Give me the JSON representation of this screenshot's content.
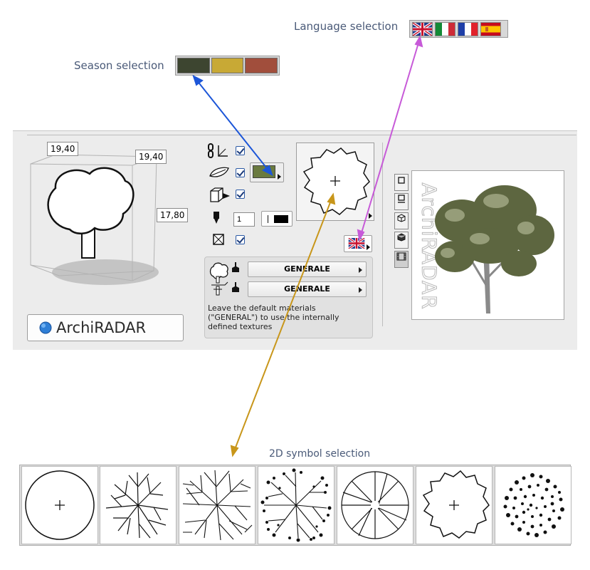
{
  "callouts": {
    "language": "Language selection",
    "season": "Season selection",
    "symbol": "2D symbol selection"
  },
  "languages": [
    {
      "name": "uk-flag-icon"
    },
    {
      "name": "italy-flag-icon"
    },
    {
      "name": "france-flag-icon"
    },
    {
      "name": "spain-flag-icon"
    }
  ],
  "seasons": [
    {
      "name": "summer",
      "color": "#3d4530"
    },
    {
      "name": "autumn",
      "color": "#c8a935"
    },
    {
      "name": "winter",
      "color": "#a14e3c"
    }
  ],
  "dimensions": {
    "width": "19,40",
    "depth": "19,40",
    "height": "17,80"
  },
  "pen": {
    "value": "1"
  },
  "materials": {
    "first": "GENERALE",
    "second": "GENERALE",
    "note": "Leave the default materials (\"GENERAL\") to use the internally defined textures"
  },
  "brand": {
    "name": "ArchiRADAR",
    "watermark": "ArchiRADAR"
  },
  "colors": {
    "season_current": "#6a7a3f",
    "arrow_blue": "#1c56d8",
    "arrow_magenta": "#c75ad8",
    "arrow_gold": "#c8961a"
  },
  "view_buttons": [
    {
      "name": "plan-view-icon",
      "glyph": "□"
    },
    {
      "name": "elevation-view-icon",
      "glyph": "⊡"
    },
    {
      "name": "axonometric-view-icon",
      "glyph": "⬡"
    },
    {
      "name": "shaded-view-icon",
      "glyph": "⬢"
    },
    {
      "name": "film-view-icon",
      "glyph": "▤"
    }
  ],
  "symbols": [
    {
      "name": "symbol-circle-cross"
    },
    {
      "name": "symbol-branches-sparse"
    },
    {
      "name": "symbol-branches-dense"
    },
    {
      "name": "symbol-branches-leaves"
    },
    {
      "name": "symbol-radial-segments"
    },
    {
      "name": "symbol-cloud-cross"
    },
    {
      "name": "symbol-foliage-speckle"
    }
  ]
}
